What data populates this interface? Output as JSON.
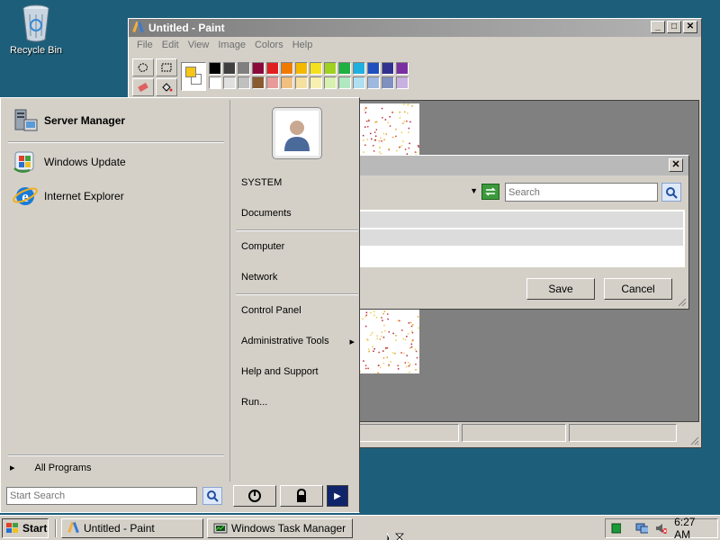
{
  "desktop": {
    "recycle_bin_label": "Recycle Bin"
  },
  "paint": {
    "title": "Untitled - Paint",
    "menu": [
      "File",
      "Edit",
      "View",
      "Image",
      "Colors",
      "Help"
    ],
    "window_buttons": {
      "minimize": "_",
      "maximize": "□",
      "close": "✕"
    },
    "foreground_color": "#f5c518",
    "background_color": "#ffffff",
    "palette": [
      "#000000",
      "#404040",
      "#808080",
      "#8b0a3a",
      "#e02020",
      "#f07a00",
      "#f5b800",
      "#f5e020",
      "#a0d020",
      "#20b040",
      "#20b0e0",
      "#2050c0",
      "#303090",
      "#7a30a0",
      "#ffffff",
      "#e0e0e0",
      "#c0c0c0",
      "#8a5a30",
      "#e89a9a",
      "#f0c080",
      "#f5e0a0",
      "#f8f0b0",
      "#d8f0b0",
      "#b0e8c0",
      "#b0e0f0",
      "#a0b8e0",
      "#8090c0",
      "#c8b0e0"
    ]
  },
  "dialog": {
    "close": "✕",
    "search_placeholder": "Search",
    "save_label": "Save",
    "cancel_label": "Cancel"
  },
  "start_menu": {
    "pinned": [
      {
        "label": "Server Manager"
      }
    ],
    "recent": [
      {
        "label": "Windows Update"
      },
      {
        "label": "Internet Explorer"
      }
    ],
    "all_programs": "All Programs",
    "search_placeholder": "Start Search",
    "right_items": {
      "user": "SYSTEM",
      "documents": "Documents",
      "computer": "Computer",
      "network": "Network",
      "control_panel": "Control Panel",
      "admin_tools": "Administrative Tools",
      "help": "Help and Support",
      "run": "Run..."
    },
    "submenu_arrow": "▸",
    "more_arrow": "▶"
  },
  "taskbar": {
    "start_label": "Start",
    "tasks": [
      {
        "label": "Untitled - Paint"
      },
      {
        "label": "Windows Task Manager"
      }
    ],
    "clock": "6:27 AM"
  }
}
